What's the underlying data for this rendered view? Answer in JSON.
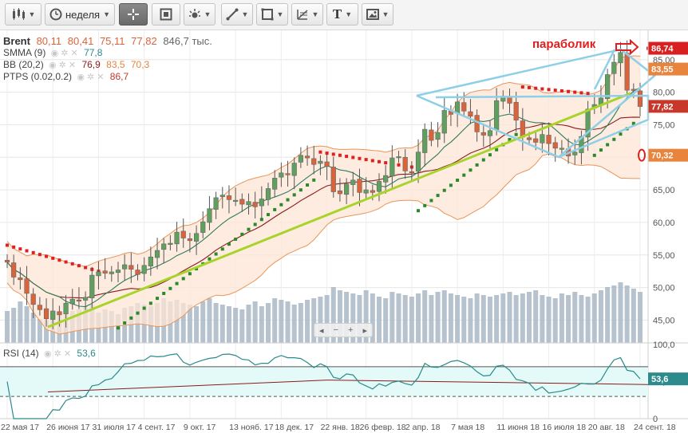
{
  "toolbar": {
    "period_label": "неделя",
    "text_tool": "T"
  },
  "legend": {
    "brent": {
      "name": "Brent",
      "values": [
        "80,11",
        "80,41",
        "75,11",
        "77,82"
      ],
      "volume": "846,7 тыс."
    },
    "smma": {
      "name": "SMMA (9)",
      "value": "77,8"
    },
    "bb": {
      "name": "BB (20,2)",
      "values": [
        "76,9",
        "83,5",
        "70,3"
      ]
    },
    "ptps": {
      "name": "PTPS (0.02,0.2)",
      "value": "86,7"
    },
    "rsi": {
      "name": "RSI (14)",
      "value": "53,6"
    }
  },
  "annotation": "параболик",
  "nav": {
    "minus": "−",
    "plus": "+"
  },
  "colors": {
    "up": "#5fa05f",
    "down": "#d9643c",
    "bb_line": "#e8955a",
    "bb_fill": "#fde6d6",
    "smma": "#2e7d5e",
    "sma2": "#8b1a1a",
    "sar": "#e02020",
    "sar_up": "#2a8a2a",
    "trend_green": "#a8d42a",
    "trend_blue": "#8ecfe8",
    "volume": "#a9b7c6",
    "rsi_line": "#2a8a8a",
    "rsi_zone": "#e4faf8"
  },
  "chart_data": {
    "type": "candlestick",
    "x_labels": [
      "22 мая 17",
      "26 июня 17",
      "31 июля 17",
      "4 сент. 17",
      "9 окт. 17",
      "13 нояб. 17",
      "18 дек. 17",
      "22 янв. 18",
      "26 февр. 18",
      "2 апр. 18",
      "7 мая 18",
      "11 июня 18",
      "16 июля 18",
      "20 авг. 18",
      "24 сент. 18"
    ],
    "y_ticks": [
      45,
      50,
      55,
      60,
      65,
      70,
      75,
      80,
      85
    ],
    "y_tick_labels": [
      "45,00",
      "50,00",
      "55,00",
      "60,00",
      "65,00",
      "70,00",
      "75,00",
      "80,00",
      "85,00"
    ],
    "ylim": [
      41.5,
      89.5
    ],
    "price_tags": [
      {
        "value": 86.74,
        "label": "86,74",
        "color": "#d92020"
      },
      {
        "value": 83.55,
        "label": "83,55",
        "color": "#e8843c"
      },
      {
        "value": 77.82,
        "label": "77,82",
        "color": "#c8382a"
      },
      {
        "value": 70.32,
        "label": "70,32",
        "color": "#e8843c"
      }
    ],
    "closes": [
      53.9,
      51.6,
      51.2,
      49.1,
      47.4,
      46.6,
      45.2,
      46.4,
      45.8,
      47.6,
      48.2,
      47.9,
      48.5,
      51.9,
      52.4,
      52.2,
      52.4,
      52.7,
      53.5,
      52.8,
      52.0,
      53.4,
      54.7,
      55.7,
      56.7,
      56.8,
      58.5,
      57.6,
      57.2,
      58.3,
      60.1,
      62.1,
      63.8,
      64.2,
      63.5,
      63.4,
      62.8,
      63.2,
      62.4,
      63.6,
      65.2,
      66.8,
      67.6,
      67.3,
      69.1,
      70.3,
      69.9,
      68.9,
      69.4,
      68.6,
      64.7,
      64.4,
      65.9,
      66.5,
      64.6,
      65.0,
      64.6,
      66.3,
      67.2,
      69.9,
      70.1,
      67.9,
      67.7,
      70.8,
      74.3,
      72.6,
      73.8,
      77.2,
      76.6,
      78.5,
      77.1,
      76.3,
      73.9,
      73.4,
      74.1,
      78.7,
      79.4,
      78.3,
      75.7,
      73.1,
      72.7,
      72.3,
      73.5,
      72.1,
      71.4,
      71.4,
      70.2,
      70.8,
      73.2,
      77.4,
      78.1,
      79.1,
      82.7,
      84.6,
      86.1,
      80.3,
      80.3,
      77.8
    ],
    "sar": {
      "bearish_start": 0,
      "bearish_end": 14,
      "bearish_from": 56.5,
      "bearish_to": 52.5,
      "bullish1_start": 17,
      "bullish1_end": 47,
      "bullish1_from": 43.8,
      "bullish1_to": 66.5,
      "bearish2_start": 48,
      "bearish2_end": 62,
      "bearish2_from": 70.8,
      "bearish2_to": 68.5,
      "bullish2_start": 63,
      "bullish2_end": 78,
      "bullish2_from": 61.8,
      "bullish2_to": 73.5,
      "bearish3_start": 79,
      "bearish3_end": 89,
      "bearish3_from": 80.8,
      "bearish3_to": 79.8,
      "bullish3_start": 90,
      "bullish3_end": 96,
      "bullish3_from": 70.3,
      "bullish3_to": 75.2
    },
    "volume_bars": [
      40,
      44,
      52,
      46,
      38,
      30,
      28,
      30,
      34,
      36,
      40,
      42,
      46,
      48,
      38,
      42,
      40,
      36,
      44,
      46,
      50,
      48,
      46,
      50,
      56,
      52,
      54,
      50,
      48,
      46,
      52,
      56,
      50,
      48,
      46,
      44,
      42,
      48,
      52,
      46,
      50,
      56,
      54,
      52,
      48,
      50,
      54,
      56,
      58,
      60,
      70,
      66,
      64,
      62,
      60,
      66,
      62,
      58,
      56,
      64,
      62,
      60,
      58,
      62,
      66,
      60,
      64,
      66,
      62,
      60,
      58,
      56,
      62,
      60,
      58,
      60,
      62,
      64,
      60,
      62,
      64,
      66,
      60,
      58,
      56,
      62,
      60,
      64,
      60,
      58,
      62,
      66,
      70,
      72,
      76,
      72,
      68,
      64
    ],
    "rsi": {
      "ylim": [
        0,
        100
      ],
      "y_tick_labels": [
        "100,0",
        "50,0",
        "0"
      ],
      "overbought": 70,
      "oversold": 30,
      "last": 53.6
    }
  }
}
